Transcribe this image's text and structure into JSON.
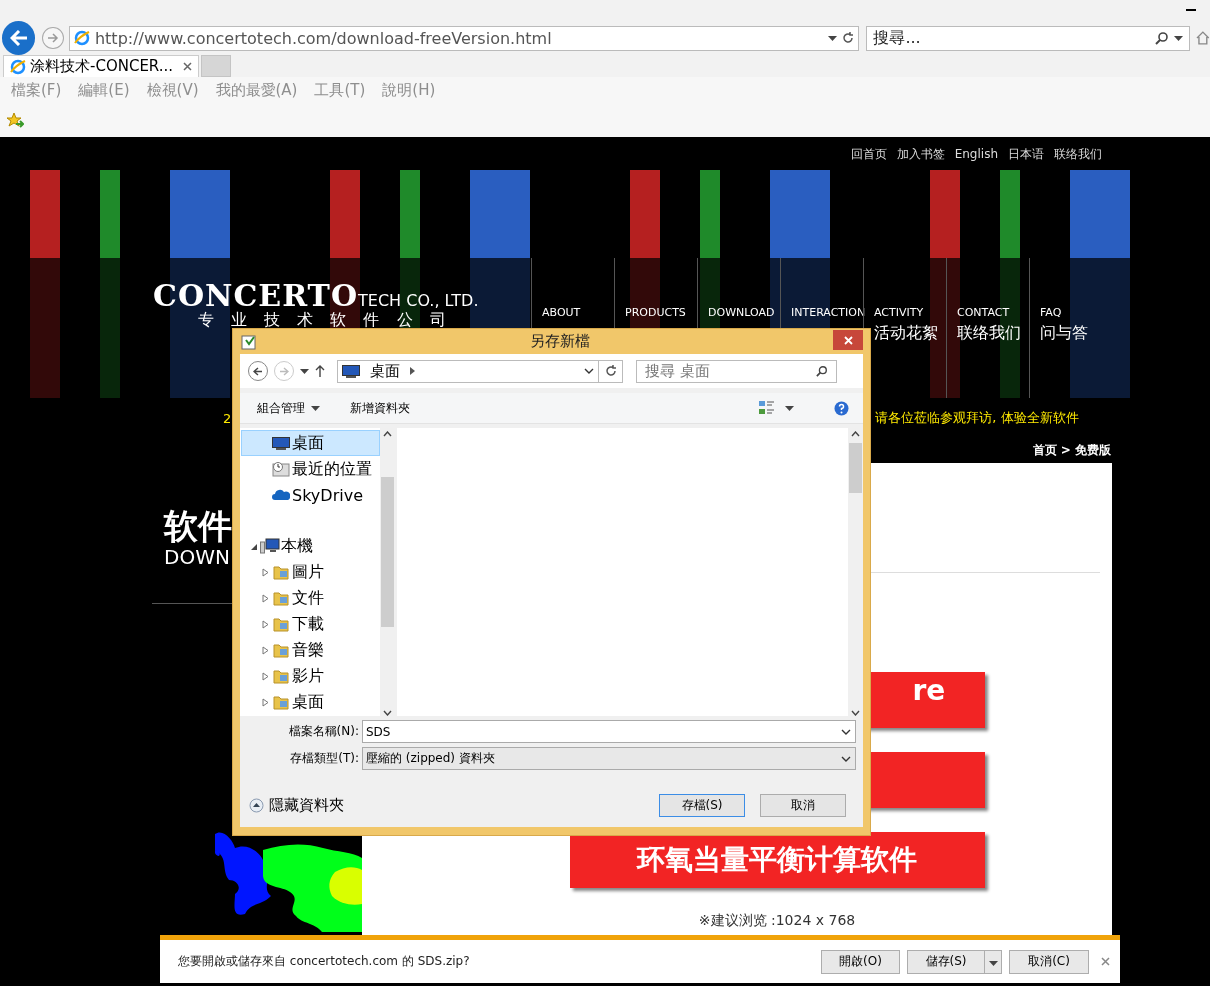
{
  "browser": {
    "address": "http://www.concertotech.com/download-freeVersion.html",
    "search_placeholder": "搜尋...",
    "tabs": [
      {
        "label": "涂料技术-CONCER...",
        "selected": true
      }
    ],
    "menu": [
      "檔案(F)",
      "編輯(E)",
      "檢視(V)",
      "我的最愛(A)",
      "工具(T)",
      "說明(H)"
    ]
  },
  "site": {
    "top_links": [
      "回首页",
      "加入书签",
      "English",
      "日本语",
      "联络我们"
    ],
    "logo": {
      "name": "CONCERTO",
      "suffix": "TECH CO., LTD.",
      "subtitle": "专 业 技 术 软 件 公 司"
    },
    "nav": [
      {
        "en": "ABOUT"
      },
      {
        "en": "PRODUCTS"
      },
      {
        "en": "DOWNLOAD"
      },
      {
        "en": "INTERACTION"
      },
      {
        "en": "ACTIVITY",
        "zh": "活动花絮"
      },
      {
        "en": "CONTACT",
        "zh": "联络我们"
      },
      {
        "en": "FAQ",
        "zh": "问与答"
      }
    ],
    "notice_start": "2",
    "notice": "请各位莅临参观拜访, 体验全新软件",
    "breadcrumb": "首页 > 免费版",
    "heading": "软件",
    "heading_en": "DOWN",
    "download_buttons": [
      {
        "kind": "partial",
        "label": "re"
      },
      {
        "kind": "hidden"
      },
      {
        "kind": "full",
        "label": "环氧当量平衡计算软件"
      }
    ],
    "resolution_note": "※建议浏览 :1024 x 768"
  },
  "dialog": {
    "title": "另存新檔",
    "path": "桌面",
    "search_placeholder": "搜尋 桌面",
    "organize": "組合管理",
    "new_folder": "新增資料夾",
    "nav_tree": [
      {
        "label": "桌面",
        "selected": true
      },
      {
        "label": "最近的位置",
        "selected": false
      },
      {
        "label": "SkyDrive",
        "selected": false
      },
      {
        "label": "本機",
        "selected": false,
        "expanded": true,
        "children": [
          {
            "label": "圖片",
            "selected": false,
            "expanded": false
          },
          {
            "label": "文件",
            "selected": false,
            "expanded": false
          },
          {
            "label": "下載",
            "selected": false,
            "expanded": false
          },
          {
            "label": "音樂",
            "selected": false,
            "expanded": false
          },
          {
            "label": "影片",
            "selected": false,
            "expanded": false
          },
          {
            "label": "桌面",
            "selected": false,
            "expanded": false
          }
        ]
      }
    ],
    "file_name_label": "檔案名稱(N):",
    "file_name": "SDS",
    "file_type_label": "存檔類型(T):",
    "file_type": "壓縮的 (zipped) 資料夾",
    "hide_folders": "隱藏資料夾",
    "buttons": [
      {
        "label": "存檔(S)",
        "default": true
      },
      {
        "label": "取消",
        "default": false
      }
    ]
  },
  "download_bar": {
    "message": "您要開啟或儲存來自 concertotech.com 的 SDS.zip?",
    "buttons": [
      "開啟(O)",
      "儲存(S)",
      "取消(C)"
    ]
  }
}
